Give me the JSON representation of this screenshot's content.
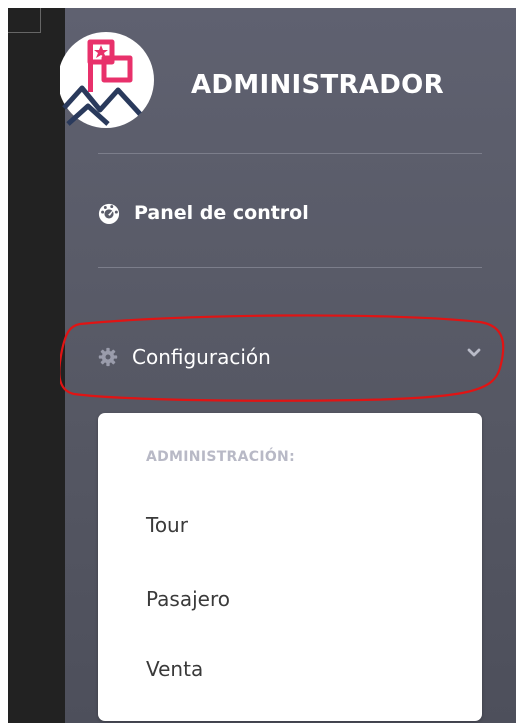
{
  "sidebar": {
    "brand_title": "ADMINISTRADOR",
    "logo_icon": "brand-logo-icon",
    "nav": {
      "dashboard": {
        "label": "Panel de control",
        "icon": "tachometer-icon"
      },
      "config": {
        "label": "Configuración",
        "icon": "gear-icon",
        "expand_icon": "chevron-down-icon"
      }
    },
    "dropdown": {
      "header": "ADMINISTRACIÓN:",
      "items": [
        {
          "label": "Tour"
        },
        {
          "label": "Pasajero"
        },
        {
          "label": "Venta"
        }
      ]
    }
  },
  "colors": {
    "sidebar_bg": "#5a5c69",
    "highlight_annotation": "#e01414",
    "logo_accent": "#e8316b",
    "logo_line": "#2a3a5c"
  }
}
